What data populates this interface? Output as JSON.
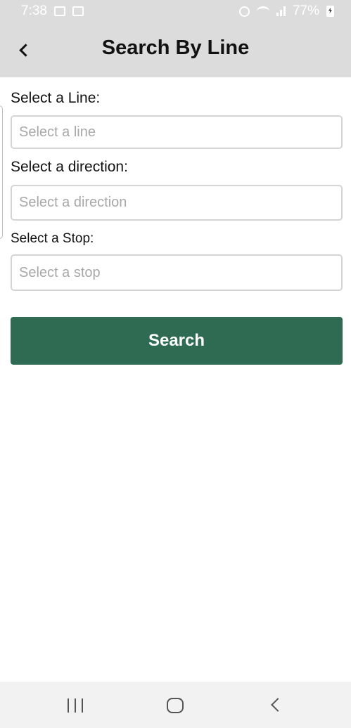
{
  "status_bar": {
    "time": "7:38",
    "battery": "77%",
    "icons": [
      "gallery-icon",
      "checkbox-icon",
      "alarm-icon",
      "wifi-icon",
      "signal-icon",
      "battery-charging-icon"
    ]
  },
  "app_bar": {
    "title": "Search By Line",
    "back_icon": "chevron-left-icon"
  },
  "form": {
    "line": {
      "label": "Select a Line:",
      "placeholder": "Select a line"
    },
    "direction": {
      "label": "Select a direction:",
      "placeholder": "Select a direction"
    },
    "stop": {
      "label": "Select a Stop:",
      "placeholder": "Select a stop"
    },
    "search_label": "Search"
  },
  "colors": {
    "app_bar_bg": "#dcdcdc",
    "primary_button": "#2e6b52",
    "placeholder_text": "#a8a8a8"
  },
  "nav_bar": {
    "icons": [
      "recents-icon",
      "home-icon",
      "back-icon"
    ]
  }
}
